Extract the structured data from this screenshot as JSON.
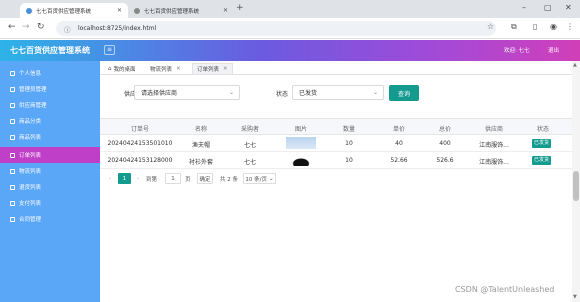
{
  "browser": {
    "tabs": [
      {
        "label": "七七百货供应管理系统",
        "active": true
      },
      {
        "label": "七七百货供应管理系统",
        "active": false
      }
    ],
    "new_tab": "+",
    "url": "localhost:8725/index.html",
    "controls": {
      "minimize": "–",
      "maximize": "▢",
      "close": "✕"
    }
  },
  "app": {
    "title": "七七百货供应管理系统",
    "menu_icon": "≡",
    "welcome": "欢迎: 七七",
    "logout": "退出",
    "accent": "#129b8e",
    "sidebar_active_color": "#c03fc8"
  },
  "sidebar": {
    "items": [
      {
        "label": "个人信息",
        "active": false
      },
      {
        "label": "管理员管理",
        "active": false
      },
      {
        "label": "供应商管理",
        "active": false
      },
      {
        "label": "商品分类",
        "active": false
      },
      {
        "label": "商品列表",
        "active": false
      },
      {
        "label": "订单列表",
        "active": true
      },
      {
        "label": "物流列表",
        "active": false
      },
      {
        "label": "退货列表",
        "active": false
      },
      {
        "label": "支付列表",
        "active": false
      },
      {
        "label": "合同管理",
        "active": false
      }
    ]
  },
  "crumbs": [
    {
      "label": "我的桌面",
      "active": false
    },
    {
      "label": "物流列表",
      "active": false
    },
    {
      "label": "订单列表",
      "active": true
    }
  ],
  "filters": {
    "supplier_label": "供应商",
    "supplier_placeholder": "请选择供应商",
    "status_label": "状态",
    "status_value": "已发货",
    "query_button": "查询"
  },
  "table": {
    "headers": [
      "订单号",
      "名称",
      "采购者",
      "图片",
      "数量",
      "单价",
      "总价",
      "供应商",
      "状态"
    ],
    "rows": [
      {
        "order_no": "20240424153501010",
        "name": "渔夫帽",
        "buyer": "七七",
        "qty": "10",
        "price": "40",
        "total": "400",
        "supplier": "江南服饰...",
        "status": "已发货"
      },
      {
        "order_no": "20240424153128000",
        "name": "衬衫外套",
        "buyer": "七七",
        "qty": "10",
        "price": "52.66",
        "total": "526.6",
        "supplier": "江南服饰...",
        "status": "已发货"
      }
    ]
  },
  "pager": {
    "prev": "‹",
    "current": "1",
    "next": "›",
    "goto_label": "到第",
    "goto_value": "1",
    "page_unit": "页",
    "confirm": "确定",
    "total": "共 2 条",
    "page_size": "10 条/页"
  },
  "watermark": "CSDN @TalentUnleashed"
}
